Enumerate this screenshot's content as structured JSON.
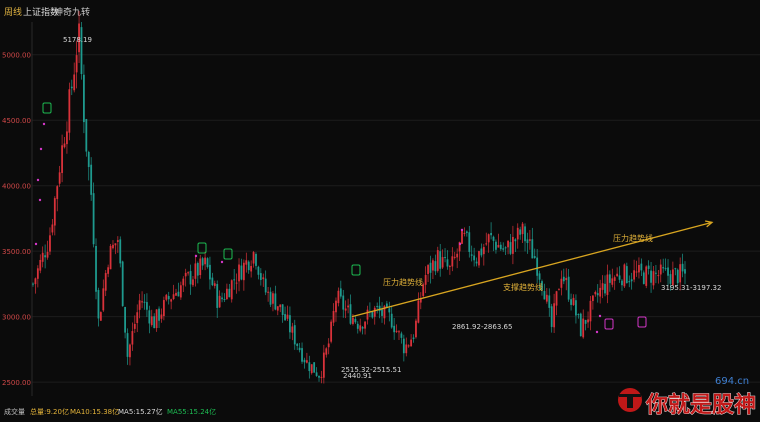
{
  "tabs": [
    {
      "label": "周线"
    },
    {
      "label": "上证指数"
    },
    {
      "label": "神奇九转"
    }
  ],
  "colors": {
    "background": "#0b0b0b",
    "up": "#d9323a",
    "down": "#1e9a8e",
    "trendline": "#d8a520",
    "label_text": "#e3b33a",
    "axis_text": "#d04848",
    "marker_green": "#1dbb52",
    "marker_magenta": "#d437c9"
  },
  "chart_data": {
    "type": "candlestick",
    "period": "weekly",
    "instrument": "上证指数",
    "ylim": [
      2440,
      5250
    ],
    "y_ticks": [
      "5000.00",
      "4500.00",
      "4000.00",
      "3500.00",
      "3000.00",
      "2500.00"
    ],
    "price_points": [
      {
        "pos": 0.0,
        "v": 3250
      },
      {
        "pos": 0.025,
        "v": 3600
      },
      {
        "pos": 0.045,
        "v": 4300
      },
      {
        "pos": 0.058,
        "v": 4700
      },
      {
        "pos": 0.07,
        "v": 5178.19
      },
      {
        "pos": 0.08,
        "v": 4400
      },
      {
        "pos": 0.09,
        "v": 3900
      },
      {
        "pos": 0.1,
        "v": 2950
      },
      {
        "pos": 0.115,
        "v": 3450
      },
      {
        "pos": 0.13,
        "v": 3600
      },
      {
        "pos": 0.145,
        "v": 2700
      },
      {
        "pos": 0.165,
        "v": 3150
      },
      {
        "pos": 0.185,
        "v": 2950
      },
      {
        "pos": 0.21,
        "v": 3150
      },
      {
        "pos": 0.24,
        "v": 3300
      },
      {
        "pos": 0.265,
        "v": 3400
      },
      {
        "pos": 0.285,
        "v": 3100
      },
      {
        "pos": 0.31,
        "v": 3300
      },
      {
        "pos": 0.34,
        "v": 3500
      },
      {
        "pos": 0.355,
        "v": 3200
      },
      {
        "pos": 0.375,
        "v": 3100
      },
      {
        "pos": 0.395,
        "v": 2900
      },
      {
        "pos": 0.42,
        "v": 2650
      },
      {
        "pos": 0.44,
        "v": 2560
      },
      {
        "pos": 0.455,
        "v": 2820
      },
      {
        "pos": 0.465,
        "v": 3150
      },
      {
        "pos": 0.48,
        "v": 3050
      },
      {
        "pos": 0.5,
        "v": 2950
      },
      {
        "pos": 0.525,
        "v": 3050
      },
      {
        "pos": 0.55,
        "v": 2980
      },
      {
        "pos": 0.57,
        "v": 2760
      },
      {
        "pos": 0.585,
        "v": 2880
      },
      {
        "pos": 0.6,
        "v": 3300
      },
      {
        "pos": 0.62,
        "v": 3450
      },
      {
        "pos": 0.64,
        "v": 3350
      },
      {
        "pos": 0.66,
        "v": 3600
      },
      {
        "pos": 0.68,
        "v": 3450
      },
      {
        "pos": 0.7,
        "v": 3600
      },
      {
        "pos": 0.725,
        "v": 3500
      },
      {
        "pos": 0.75,
        "v": 3650
      },
      {
        "pos": 0.77,
        "v": 3450
      },
      {
        "pos": 0.785,
        "v": 3200
      },
      {
        "pos": 0.795,
        "v": 2900
      },
      {
        "pos": 0.81,
        "v": 3350
      },
      {
        "pos": 0.825,
        "v": 3150
      },
      {
        "pos": 0.84,
        "v": 2900
      },
      {
        "pos": 0.855,
        "v": 3050
      },
      {
        "pos": 0.87,
        "v": 3200
      },
      {
        "pos": 0.89,
        "v": 3300
      },
      {
        "pos": 0.9,
        "v": 3320
      }
    ],
    "annotations": {
      "high_label": "5178.19",
      "low_label": "2440.91",
      "low_range": "2515.32-2515.51",
      "mid_range": "2861.92-2863.65",
      "right_range": "3195.31-3197.32",
      "pressure_left": "压力趋势线",
      "support": "支撑趋势线",
      "pressure_right": "压力趋势线"
    },
    "trendline": {
      "from": 3000,
      "to": 3720
    }
  },
  "bottom_bar": {
    "label": "成交量",
    "total": "总量:9.20亿",
    "ma10": "MA10:15.38亿",
    "ma5": "MA5:15.27亿",
    "ma55": "MA55:15.24亿"
  },
  "watermark": {
    "site": "694.cn",
    "brand": "你就是股神"
  }
}
